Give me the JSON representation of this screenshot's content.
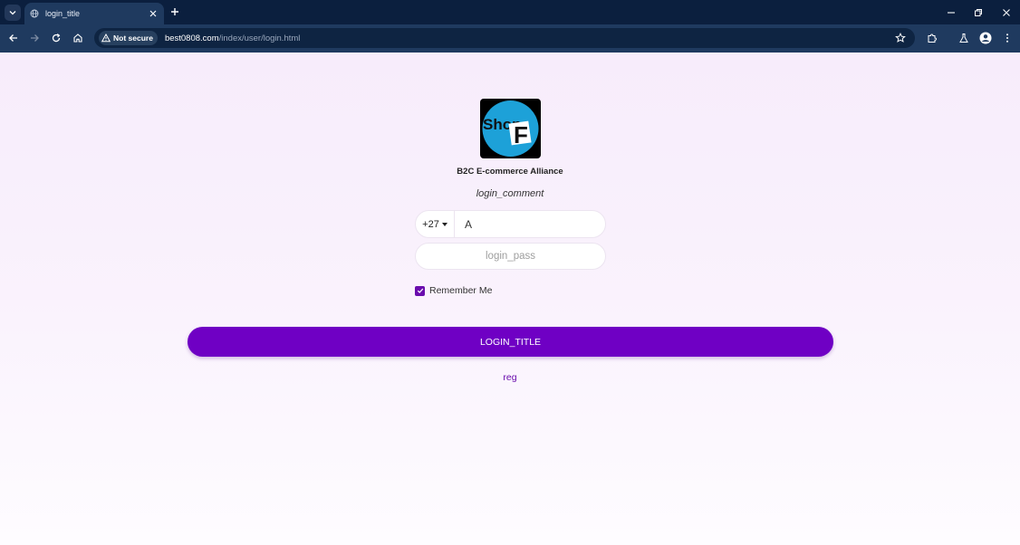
{
  "browser": {
    "tab_title": "login_title",
    "security_label": "Not secure",
    "url_host": "best0808.com",
    "url_path": "/index/user/login.html"
  },
  "page": {
    "brand": "B2C E-commerce Alliance",
    "logo_text": "Shop",
    "logo_letter": "F",
    "comment": "login_comment",
    "country_code": "+27",
    "phone_value": "A",
    "password_placeholder": "login_pass",
    "remember_label": "Remember Me",
    "remember_checked": true,
    "login_button": "LOGIN_TITLE",
    "reg_link": "reg"
  },
  "colors": {
    "accent": "#6f00c4",
    "chrome_dark": "#0b1f3e",
    "chrome_toolbar": "#1f3a5f",
    "logo_circle": "#1da1d8"
  }
}
